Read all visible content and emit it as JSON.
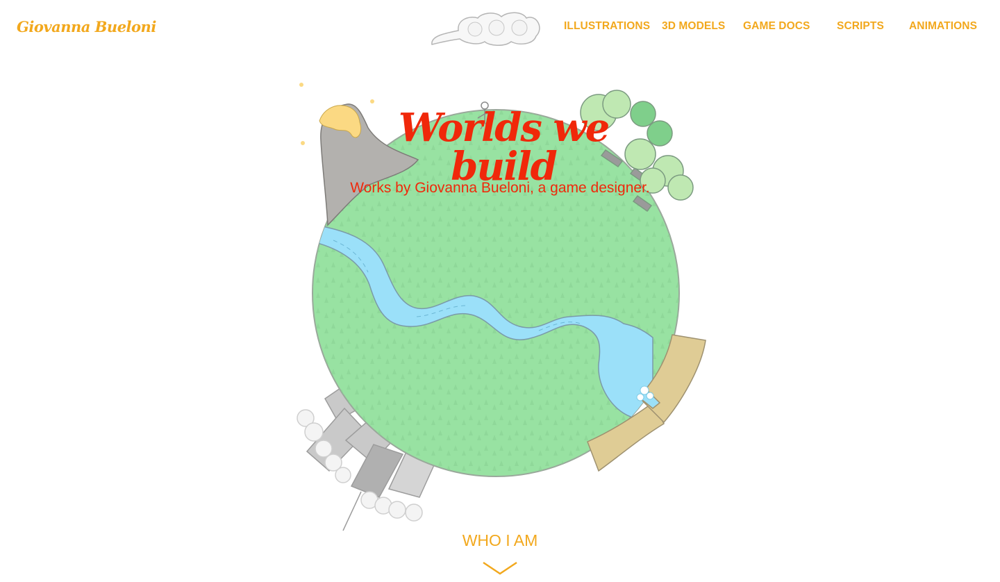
{
  "header": {
    "logo_text": "Giovanna Bueloni",
    "nav": [
      {
        "label": "ILLUSTRATIONS"
      },
      {
        "label": "3D MODELS"
      },
      {
        "label": "GAME DOCS"
      },
      {
        "label": "SCRIPTS"
      },
      {
        "label": "ANIMATIONS"
      }
    ]
  },
  "hero": {
    "title": "Worlds we build",
    "subtitle": "Works by Giovanna Bueloni, a game designer."
  },
  "scroll": {
    "label": "WHO I AM",
    "icon": "chevron-down-icon"
  },
  "colors": {
    "accent": "#f2a81d",
    "hero_text": "#f0280a",
    "planet": "#98e2a2",
    "river": "#9be0f9",
    "sand": "#dfcc95",
    "volcano": "#b3b1ae",
    "lava": "#fbd983",
    "buildings": "#c8c8c8",
    "background": "#ffffff"
  }
}
